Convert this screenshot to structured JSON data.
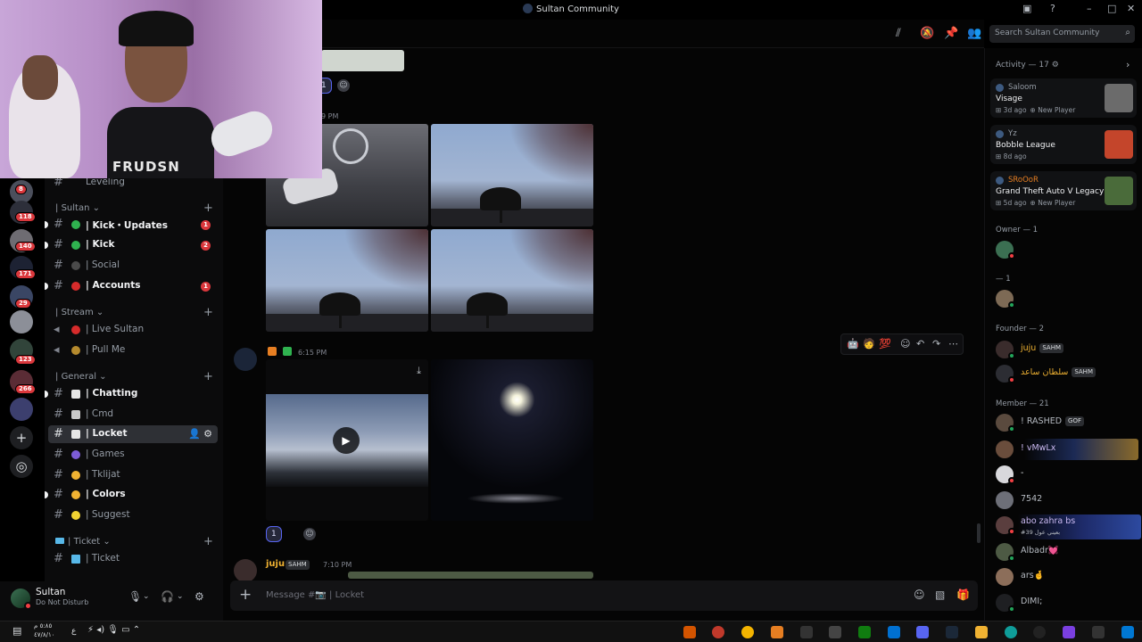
{
  "window": {
    "title": "Sultan Community"
  },
  "header": {
    "search_placeholder": "Search Sultan Community"
  },
  "rail": {
    "badges": [
      "8",
      "118",
      "140",
      "171",
      "29",
      "123",
      "266"
    ]
  },
  "channels": {
    "top_partial": "Leveling",
    "categories": [
      {
        "label": "Sultan"
      },
      {
        "label": "Stream"
      },
      {
        "label": "General"
      },
      {
        "label": "Ticket"
      }
    ],
    "items": [
      {
        "label": "| Kick・Updates",
        "badge": "1",
        "unread": true,
        "emoji_color": "#2fb24f"
      },
      {
        "label": "| Kick",
        "badge": "2",
        "unread": true,
        "emoji_color": "#2fb24f"
      },
      {
        "label": "| Social",
        "badge": "",
        "unread": false,
        "emoji_color": "#4a4a4a"
      },
      {
        "label": "| Accounts",
        "badge": "1",
        "unread": true,
        "emoji_color": "#d62b2b"
      },
      {
        "label": "| Live Sultan",
        "badge": "",
        "unread": false,
        "emoji_color": "#d62b2b"
      },
      {
        "label": "| Pull Me",
        "badge": "",
        "unread": false,
        "emoji_color": "#b58a2e"
      },
      {
        "label": "| Chatting",
        "badge": "",
        "unread": true,
        "emoji_color": "#e6e6e6"
      },
      {
        "label": "| Cmd",
        "badge": "",
        "unread": false,
        "emoji_color": "#c9c9c9"
      },
      {
        "label": "| Locket",
        "badge": "",
        "unread": false,
        "emoji_color": "#e6e6e6"
      },
      {
        "label": "| Games",
        "badge": "",
        "unread": false,
        "emoji_color": "#7c5cd6"
      },
      {
        "label": "| Tklijat",
        "badge": "",
        "unread": false,
        "emoji_color": "#f0b232"
      },
      {
        "label": "| Colors",
        "badge": "",
        "unread": true,
        "emoji_color": "#f0b232"
      },
      {
        "label": "| Suggest",
        "badge": "",
        "unread": false,
        "emoji_color": "#f0d232"
      },
      {
        "label": "| Ticket",
        "badge": "",
        "unread": false,
        "emoji_color": "#58b8e8"
      }
    ]
  },
  "user": {
    "name": "Sultan",
    "status": "Do Not Disturb"
  },
  "chat": {
    "msg1_time": "9 PM",
    "msg1_reaction_count": "1",
    "msg2_time": "6:15 PM",
    "msg2_reaction_count": "1",
    "msg3_author": "juju",
    "msg3_tag": "SAHM",
    "msg3_time": "7:10 PM",
    "composer_placeholder": "Message #📷 | Locket"
  },
  "members": {
    "activity_title": "Activity — 17",
    "activities": [
      {
        "user": "Saloom",
        "game": "Visage",
        "ago": "3d ago",
        "extra": "New Player",
        "thumb_color": "#6b6b6b"
      },
      {
        "user": "Yz",
        "game": "Bobble League",
        "ago": "8d ago",
        "extra": "",
        "thumb_color": "#c4452b"
      },
      {
        "user": "SRoOoR",
        "game": "Grand Theft Auto V Legacy",
        "ago": "5d ago",
        "extra": "New Player",
        "thumb_color": "#4a6b3a"
      }
    ],
    "groups": [
      {
        "label": "Owner — 1"
      },
      {
        "label": "— 1"
      },
      {
        "label": "Founder — 2"
      },
      {
        "label": "Member — 21"
      }
    ],
    "founders": [
      {
        "name": "juju",
        "tag": "SAHM",
        "color": "#f0b232"
      },
      {
        "name": "سلطان ساعد",
        "tag": "SAHM",
        "color": "#f0b232"
      }
    ],
    "member_list": [
      {
        "name": "! RASHED",
        "tag": "GOF",
        "sub": ""
      },
      {
        "name": "! vMwLx",
        "tag": "",
        "sub": ""
      },
      {
        "name": "-",
        "tag": "",
        "sub": ""
      },
      {
        "name": "7542",
        "tag": "",
        "sub": ""
      },
      {
        "name": "abo zahra bs",
        "tag": "",
        "sub": "#39 بعيني عول"
      },
      {
        "name": "Albadr💓",
        "tag": "",
        "sub": ""
      },
      {
        "name": "ars🤞",
        "tag": "",
        "sub": ""
      },
      {
        "name": "DIMI;",
        "tag": "",
        "sub": ""
      }
    ]
  },
  "webcam": {
    "shirt_text": "FRUDSN"
  },
  "taskbar": {
    "time": "٥:٨٥ م",
    "date": "٤٧/٨/١٠",
    "lang": "ع"
  }
}
